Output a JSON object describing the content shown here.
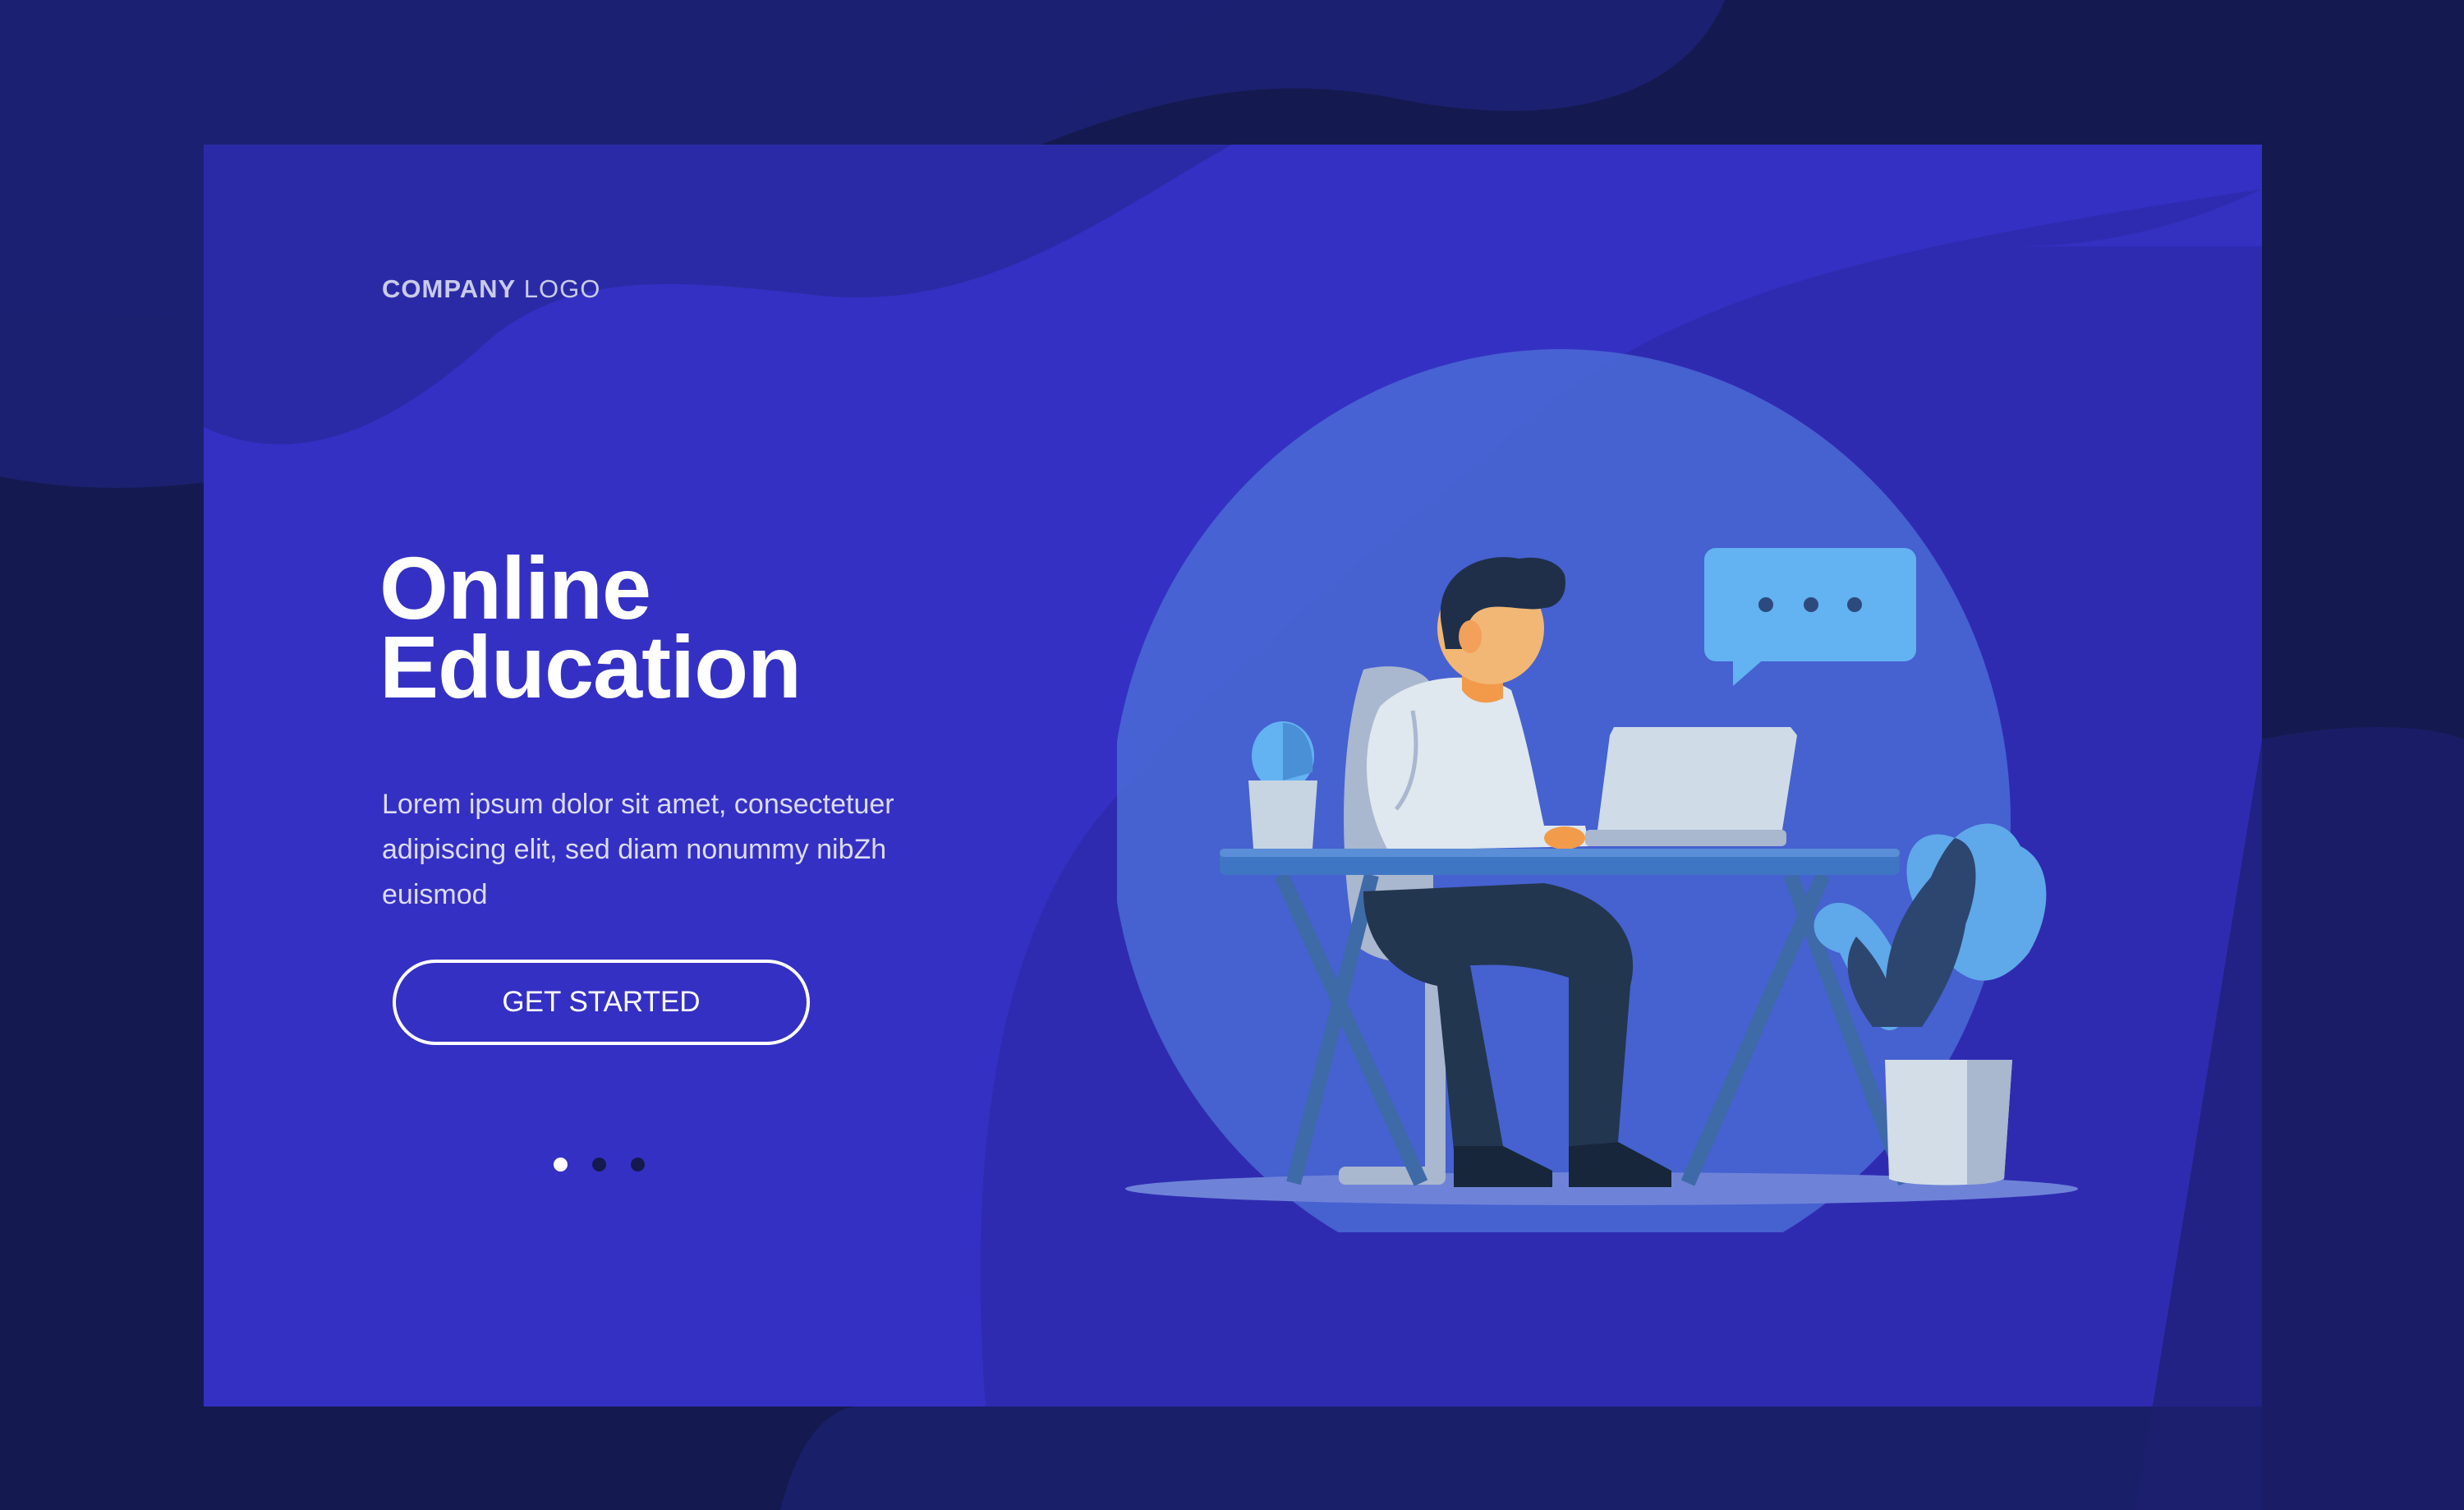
{
  "logo": {
    "bold": "COMPANY",
    "light": "LOGO"
  },
  "hero": {
    "title_line1": "Online",
    "title_line2": "Education",
    "description_line1": "Lorem ipsum dolor sit amet, consectetuer",
    "description_line2": "adipiscing elit, sed diam nonummy nibZh",
    "description_line3": "euismod",
    "cta_label": "GET STARTED"
  },
  "carousel": {
    "total": 3,
    "active_index": 0
  },
  "colors": {
    "outer_bg": "#141a4f",
    "panel_bg": "#3530c4",
    "accent_circle": "#4a6bd6",
    "button_border": "#ffffff",
    "text_white": "#ffffff"
  },
  "icons": [
    "chat-bubble-icon",
    "laptop-icon",
    "plant-icon",
    "cactus-icon"
  ]
}
